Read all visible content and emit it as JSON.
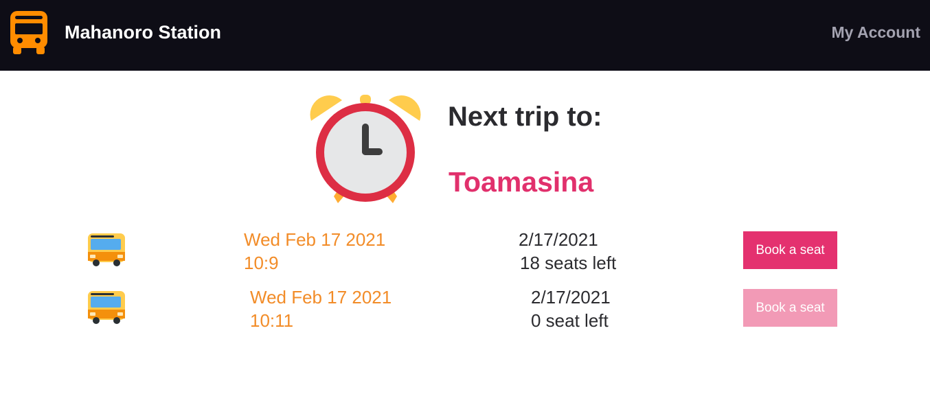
{
  "header": {
    "title": "Mahanoro Station",
    "account_link": "My Account",
    "logo_icon": "bus-front-icon"
  },
  "hero": {
    "icon": "alarm-clock-icon",
    "heading": "Next trip to:",
    "destination": "Toamasina"
  },
  "colors": {
    "header_bg": "#0e0d16",
    "accent_pink": "#e4316f",
    "disabled_pink": "#f29ab6",
    "time_orange": "#f28c28"
  },
  "trips": [
    {
      "icon": "bus-icon",
      "day": "Wed Feb 17 2021",
      "time": "10:9",
      "date": "2/17/2021",
      "seats": "18 seats left",
      "button": "Book a seat",
      "available": true
    },
    {
      "icon": "bus-icon",
      "day": "Wed Feb 17 2021",
      "time": "10:11",
      "date": "2/17/2021",
      "seats": "0 seat left",
      "button": "Book a seat",
      "available": false
    }
  ]
}
